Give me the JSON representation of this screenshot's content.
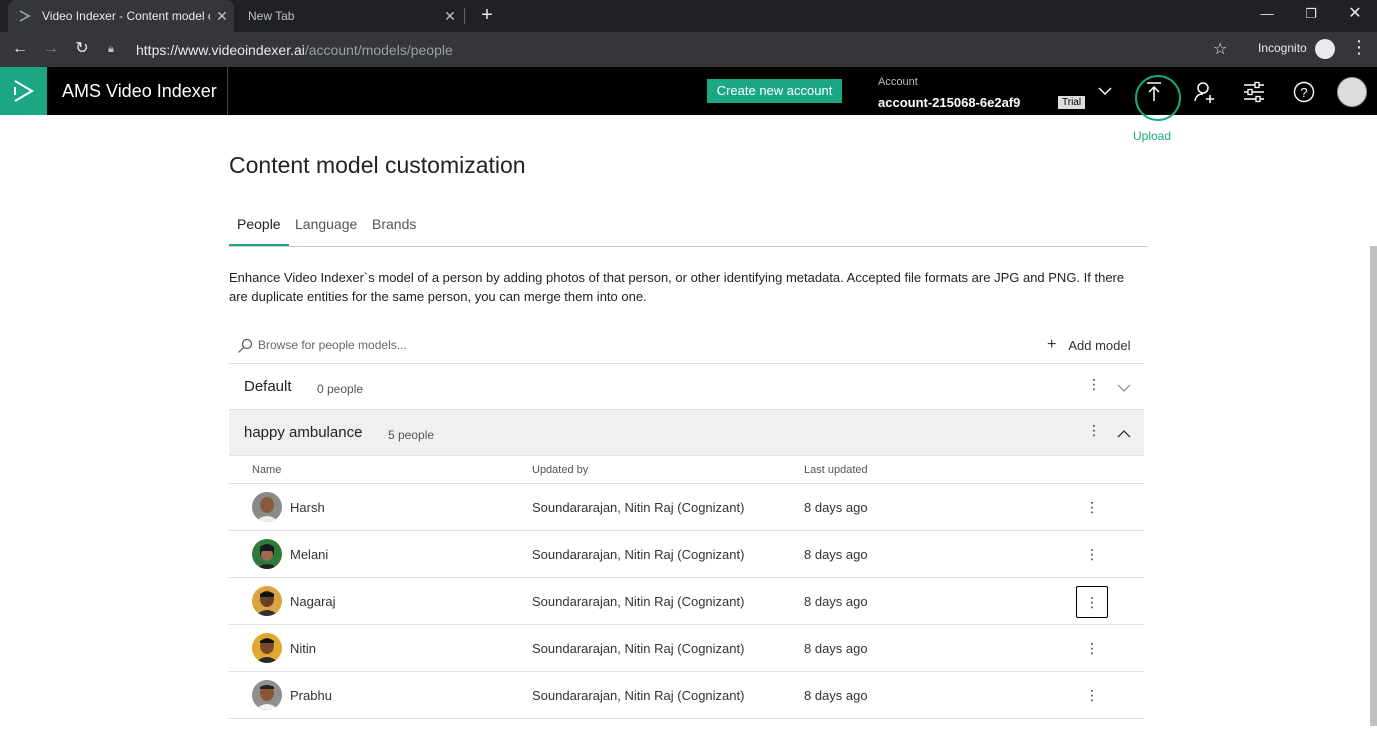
{
  "browser": {
    "tabs": [
      {
        "title": "Video Indexer - Content model c",
        "close": "✕"
      },
      {
        "title": "New Tab",
        "close": "✕"
      }
    ],
    "new_tab": "+",
    "url_host": "https://www.videoindexer.ai",
    "url_path": "/account/models/people",
    "incognito_label": "Incognito"
  },
  "header": {
    "app_name": "AMS Video Indexer",
    "create_account_label": "Create new account",
    "account_label": "Account",
    "account_name": "account-215068-6e2af9",
    "trial_badge": "Trial",
    "upload_label": "Upload"
  },
  "page": {
    "title": "Content model customization",
    "tabs": [
      {
        "label": "People"
      },
      {
        "label": "Language"
      },
      {
        "label": "Brands"
      }
    ],
    "description": "Enhance Video Indexer`s model of a person by adding photos of that person, or other identifying metadata. Accepted file formats are JPG and PNG. If there are duplicate entities for the same person, you can merge them into one.",
    "search_placeholder": "Browse for people models...",
    "add_model_label": "Add model",
    "more_glyph": "⋮"
  },
  "groups": [
    {
      "name": "Default",
      "count": "0 people"
    },
    {
      "name": "happy ambulance",
      "count": "5 people"
    }
  ],
  "columns": {
    "name": "Name",
    "updated_by": "Updated by",
    "last_updated": "Last updated"
  },
  "people": [
    {
      "name": "Harsh",
      "updated_by": "Soundararajan, Nitin Raj (Cognizant)",
      "last_updated": "8 days ago"
    },
    {
      "name": "Melani",
      "updated_by": "Soundararajan, Nitin Raj (Cognizant)",
      "last_updated": "8 days ago"
    },
    {
      "name": "Nagaraj",
      "updated_by": "Soundararajan, Nitin Raj (Cognizant)",
      "last_updated": "8 days ago"
    },
    {
      "name": "Nitin",
      "updated_by": "Soundararajan, Nitin Raj (Cognizant)",
      "last_updated": "8 days ago"
    },
    {
      "name": "Prabhu",
      "updated_by": "Soundararajan, Nitin Raj (Cognizant)",
      "last_updated": "8 days ago"
    }
  ],
  "colors": {
    "accent": "#1ba784",
    "header_bg": "#000000"
  }
}
